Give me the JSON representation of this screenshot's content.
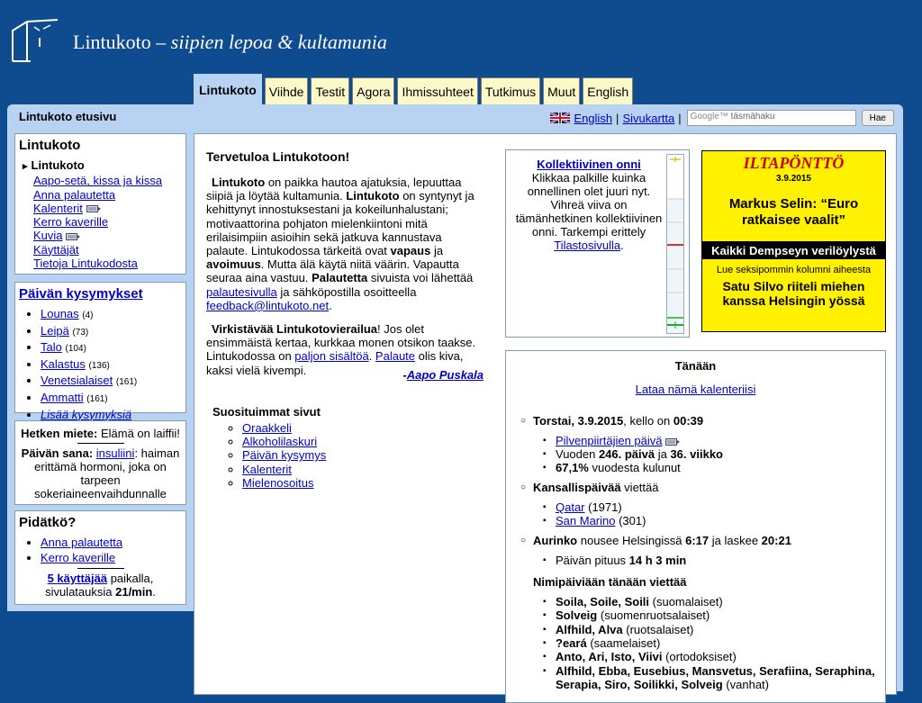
{
  "site": {
    "name": "Lintukoto",
    "dash": " – ",
    "tagline": "siipien lepoa & kultamunia"
  },
  "tabs": [
    {
      "label": "Lintukoto",
      "active": true
    },
    {
      "label": "Viihde"
    },
    {
      "label": "Testit"
    },
    {
      "label": "Agora"
    },
    {
      "label": "Ihmissuhteet"
    },
    {
      "label": "Tutkimus"
    },
    {
      "label": "Muut"
    },
    {
      "label": "English"
    }
  ],
  "topbar": {
    "breadcrumb": "Lintukoto etusivu",
    "english_link": "English",
    "separator": "|",
    "sitemap_link": "Sivukartta",
    "search_placeholder": "täsmähaku",
    "search_brand": "Google™",
    "search_button": "Hae"
  },
  "nav_box": {
    "title": "Lintukoto",
    "items": [
      {
        "label": "Lintukoto"
      },
      {
        "label": "Aapo-setä, kissa ja kissa"
      },
      {
        "label": "Anna palautetta"
      },
      {
        "label": "Kalenterit"
      },
      {
        "label": "Kerro kaverille"
      },
      {
        "label": "Kuvia"
      },
      {
        "label": "Käyttäjät"
      },
      {
        "label": "Tietoja Lintukodosta"
      }
    ]
  },
  "questions_box": {
    "title": "Päivän kysymykset",
    "items": [
      {
        "label": "Lounas",
        "count": "(4)"
      },
      {
        "label": "Leipä",
        "count": "(73)"
      },
      {
        "label": "Talo",
        "count": "(104)"
      },
      {
        "label": "Kalastus",
        "count": "(136)"
      },
      {
        "label": "Venetsialaiset",
        "count": "(161)"
      },
      {
        "label": "Ammatti",
        "count": "(161)"
      }
    ],
    "more": "Lisää kysymyksiä"
  },
  "moment_box": {
    "thought_label": "Hetken miete:",
    "thought": " Elämä on laiffii!",
    "word_label": "Päivän sana:",
    "word_link": "insuliini",
    "word_def": ": haiman erittämä hormoni, joka on tarpeen sokeriaineenvaihdunnalle"
  },
  "like_box": {
    "title": "Pidätkö?",
    "items": [
      {
        "label": "Anna palautetta"
      },
      {
        "label": "Kerro kaverille"
      }
    ],
    "users_link": "5 käyttäjää",
    "users_text": " paikalla,",
    "rate_text": "sivulatauksia ",
    "rate_value": "21/min",
    "rate_end": "."
  },
  "intro": {
    "title": "Tervetuloa Lintukotoon!",
    "p1_b1": "Lintukoto",
    "p1_t1": " on paikka hautoa ajatuksia, lepuuttaa siipiä ja löytää kultamunia. ",
    "p1_b2": "Lintukoto",
    "p1_t2": " on syntynyt ja kehittynyt innostuksestani ja kokeilunhalustani; motivaattorina pohjaton mielenkiintoni mitä erilaisimpiin asioihin sekä jatkuva kannustava palaute. Lintukodossa tärkeitä ovat ",
    "p1_b3": "vapaus",
    "p1_t3": " ja ",
    "p1_b4": "avoimuus",
    "p1_t4": ". Mutta älä käytä niitä väärin. Vapautta seuraa aina vastuu. ",
    "p1_b5": "Palautetta",
    "p1_t5": " sivuista voi lähettää ",
    "p1_l1": "palautesivulla",
    "p1_t6": " ja sähköpostilla osoitteella ",
    "p1_l2": "feedback@lintukoto.net",
    "p1_t7": ".",
    "p2_b1": "Virkistävää Lintukotovierailua",
    "p2_t1": "! Jos olet ensimmäistä kertaa, kurkkaa monen otsikon taakse. Lintukodossa on ",
    "p2_l1": "paljon sisältöä",
    "p2_t2": ". ",
    "p2_l2": "Palaute",
    "p2_t3": " olis kiva, kaksi vielä kivempi.",
    "sig_dash": "-",
    "signature": "Aapo Puskala"
  },
  "popular": {
    "title": "Suosituimmat sivut",
    "items": [
      {
        "label": "Oraakkeli"
      },
      {
        "label": "Alkoholilaskuri"
      },
      {
        "label": "Päivän kysymys"
      },
      {
        "label": "Kalenterit"
      },
      {
        "label": "Mielenosoitus"
      }
    ]
  },
  "onni": {
    "title": "Kollektiivinen onni",
    "text": "Klikkaa palkille kuinka onnellinen olet juuri nyt. Vihreä viiva on tämänhetkinen kollektiivinen onni. Tarkempi erittely",
    "link": "Tilastosivulla",
    "end": "."
  },
  "ad": {
    "title": "ILTAPÖNTTÖ",
    "date": "3.9.2015",
    "headline": "Markus Selin: “Euro ratkaisee vaalit”",
    "black": "Kaikki Dempseyn verilöylystä",
    "sub": "Lue seksipommin kolumni aiheesta",
    "bottom": "Satu Silvo riiteli miehen kanssa Helsingin yössä",
    "colors": {
      "bg": "#fff100",
      "title": "#cc0000"
    }
  },
  "today": {
    "title": "Tänään",
    "load_link": "Lataa nämä kalenteriisi",
    "date_bold": "Torstai, 3.9.2015",
    "date_mid": ", kello on ",
    "time": "00:39",
    "cloud_link": "Pilvenpiirtäjien päivä",
    "year_pre": "Vuoden ",
    "day_no": "246. päivä",
    "year_mid": " ja ",
    "week_no": "36. viikko",
    "percent": "67,1%",
    "percent_text": " vuodesta kulunut",
    "national_bold": "Kansallispäivää",
    "national_text": " viettää",
    "national": [
      {
        "label": "Qatar",
        "year": " (1971)"
      },
      {
        "label": "San Marino",
        "year": " (301)"
      }
    ],
    "sun_bold": "Aurinko",
    "sun_t1": " nousee Helsingissä ",
    "sunrise": "6:17",
    "sun_t2": " ja laskee ",
    "sunset": "20:21",
    "length_pre": "Päivän pituus ",
    "length": "14 h 3 min",
    "namedays_title": "Nimipäiviään tänään viettää",
    "namedays": [
      {
        "names": "Soila, Soile, Soili",
        "group": " (suomalaiset)"
      },
      {
        "names": "Solveig",
        "group": " (suomenruotsalaiset)"
      },
      {
        "names": "Alfhild, Alva",
        "group": " (ruotsalaiset)"
      },
      {
        "names": "?eará",
        "group": " (saamelaiset)"
      },
      {
        "names": "Anto, Ari, Isto, Viivi",
        "group": " (ortodoksiset)"
      },
      {
        "names": "Alfhild, Ebba, Eusebius, Mansvetus, Serafiina, Seraphina, Serapia, Siro, Soilikki, Solveig",
        "group": " (vanhat)"
      }
    ]
  }
}
